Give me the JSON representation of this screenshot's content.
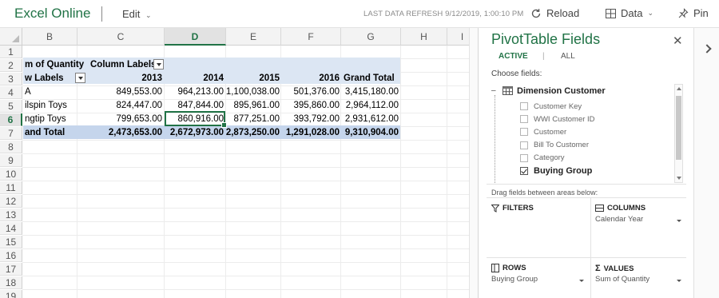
{
  "header": {
    "app_name": "Excel Online",
    "edit_label": "Edit",
    "refresh_text": "LAST DATA REFRESH 9/12/2019, 1:00:10 PM",
    "reload_label": "Reload",
    "data_label": "Data",
    "pin_label": "Pin"
  },
  "sheet": {
    "columns": [
      "B",
      "C",
      "D",
      "E",
      "F",
      "G",
      "H",
      "I"
    ],
    "active_column": "D",
    "rows": [
      "1",
      "2",
      "3",
      "4",
      "5",
      "6",
      "7",
      "8",
      "9",
      "10",
      "11",
      "12",
      "13",
      "14",
      "15",
      "16",
      "17",
      "18",
      "19"
    ],
    "active_row": "6",
    "pivot": {
      "header_left": "m of Quantity",
      "column_labels": "Column Labels",
      "row_labels": "w Labels",
      "years": [
        "2013",
        "2014",
        "2015",
        "2016"
      ],
      "grand_total_label": "Grand Total",
      "data_rows": [
        {
          "label": "A",
          "values": [
            "849,553.00",
            "964,213.00",
            "1,100,038.00",
            "501,376.00",
            "3,415,180.00"
          ]
        },
        {
          "label": "ilspin Toys",
          "values": [
            "824,447.00",
            "847,844.00",
            "895,961.00",
            "395,860.00",
            "2,964,112.00"
          ]
        },
        {
          "label": "ngtip Toys",
          "values": [
            "799,653.00",
            "860,916.00",
            "877,251.00",
            "393,792.00",
            "2,931,612.00"
          ]
        }
      ],
      "total_row": {
        "label": "and Total",
        "values": [
          "2,473,653.00",
          "2,672,973.00",
          "2,873,250.00",
          "1,291,028.00",
          "9,310,904.00"
        ]
      }
    }
  },
  "pivot_pane": {
    "title": "PivotTable Fields",
    "tab_active": "ACTIVE",
    "tab_separator": "|",
    "tab_all": "ALL",
    "choose_fields": "Choose fields:",
    "dimension": "Dimension Customer",
    "fields": [
      {
        "name": "Customer Key",
        "checked": false
      },
      {
        "name": "WWI Customer ID",
        "checked": false
      },
      {
        "name": "Customer",
        "checked": false
      },
      {
        "name": "Bill To Customer",
        "checked": false
      },
      {
        "name": "Category",
        "checked": false
      },
      {
        "name": "Buying Group",
        "checked": true
      }
    ],
    "drag_hint": "Drag fields between areas below:",
    "areas": {
      "filters": {
        "title": "FILTERS"
      },
      "columns": {
        "title": "COLUMNS",
        "item": "Calendar Year"
      },
      "rows": {
        "title": "ROWS",
        "item": "Buying Group"
      },
      "values": {
        "title": "VALUES",
        "item": "Sum of Quantity"
      }
    }
  },
  "colors": {
    "accent": "#217346",
    "pivot_band": "#dce6f3",
    "pivot_total": "#c5d5ec"
  }
}
